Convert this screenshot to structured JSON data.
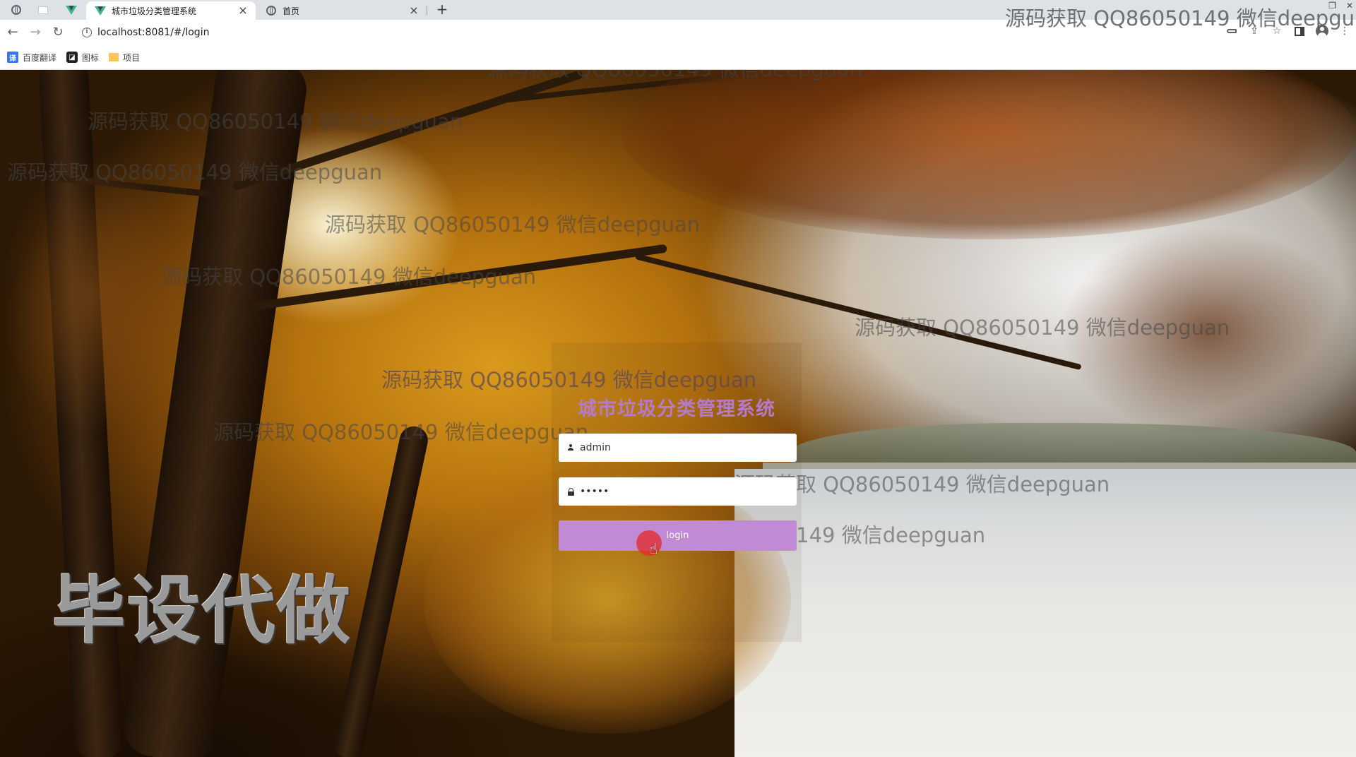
{
  "browser": {
    "tabs": [
      {
        "label": "城市垃圾分类管理系统",
        "active": true
      },
      {
        "label": "首页",
        "active": false
      }
    ],
    "close_glyph": "×",
    "new_tab_glyph": "+",
    "address": "localhost:8081/#/login",
    "bookmarks": [
      {
        "label": "百度翻译",
        "icon": "baidu-translate-icon"
      },
      {
        "label": "图标",
        "icon": "icons-bookmark-icon"
      },
      {
        "label": "项目",
        "icon": "folder-icon"
      }
    ]
  },
  "watermarks": {
    "top_right": "源码获取 QQ86050149 微信deepgu",
    "repeat": "源码获取 QQ86050149 微信deepguan",
    "big": "毕设代做"
  },
  "login": {
    "title": "城市垃圾分类管理系统",
    "username_value": "admin",
    "password_value": "•••••",
    "button_label": "login"
  },
  "colors": {
    "accent": "#c08ad4",
    "title": "#b57acb"
  }
}
